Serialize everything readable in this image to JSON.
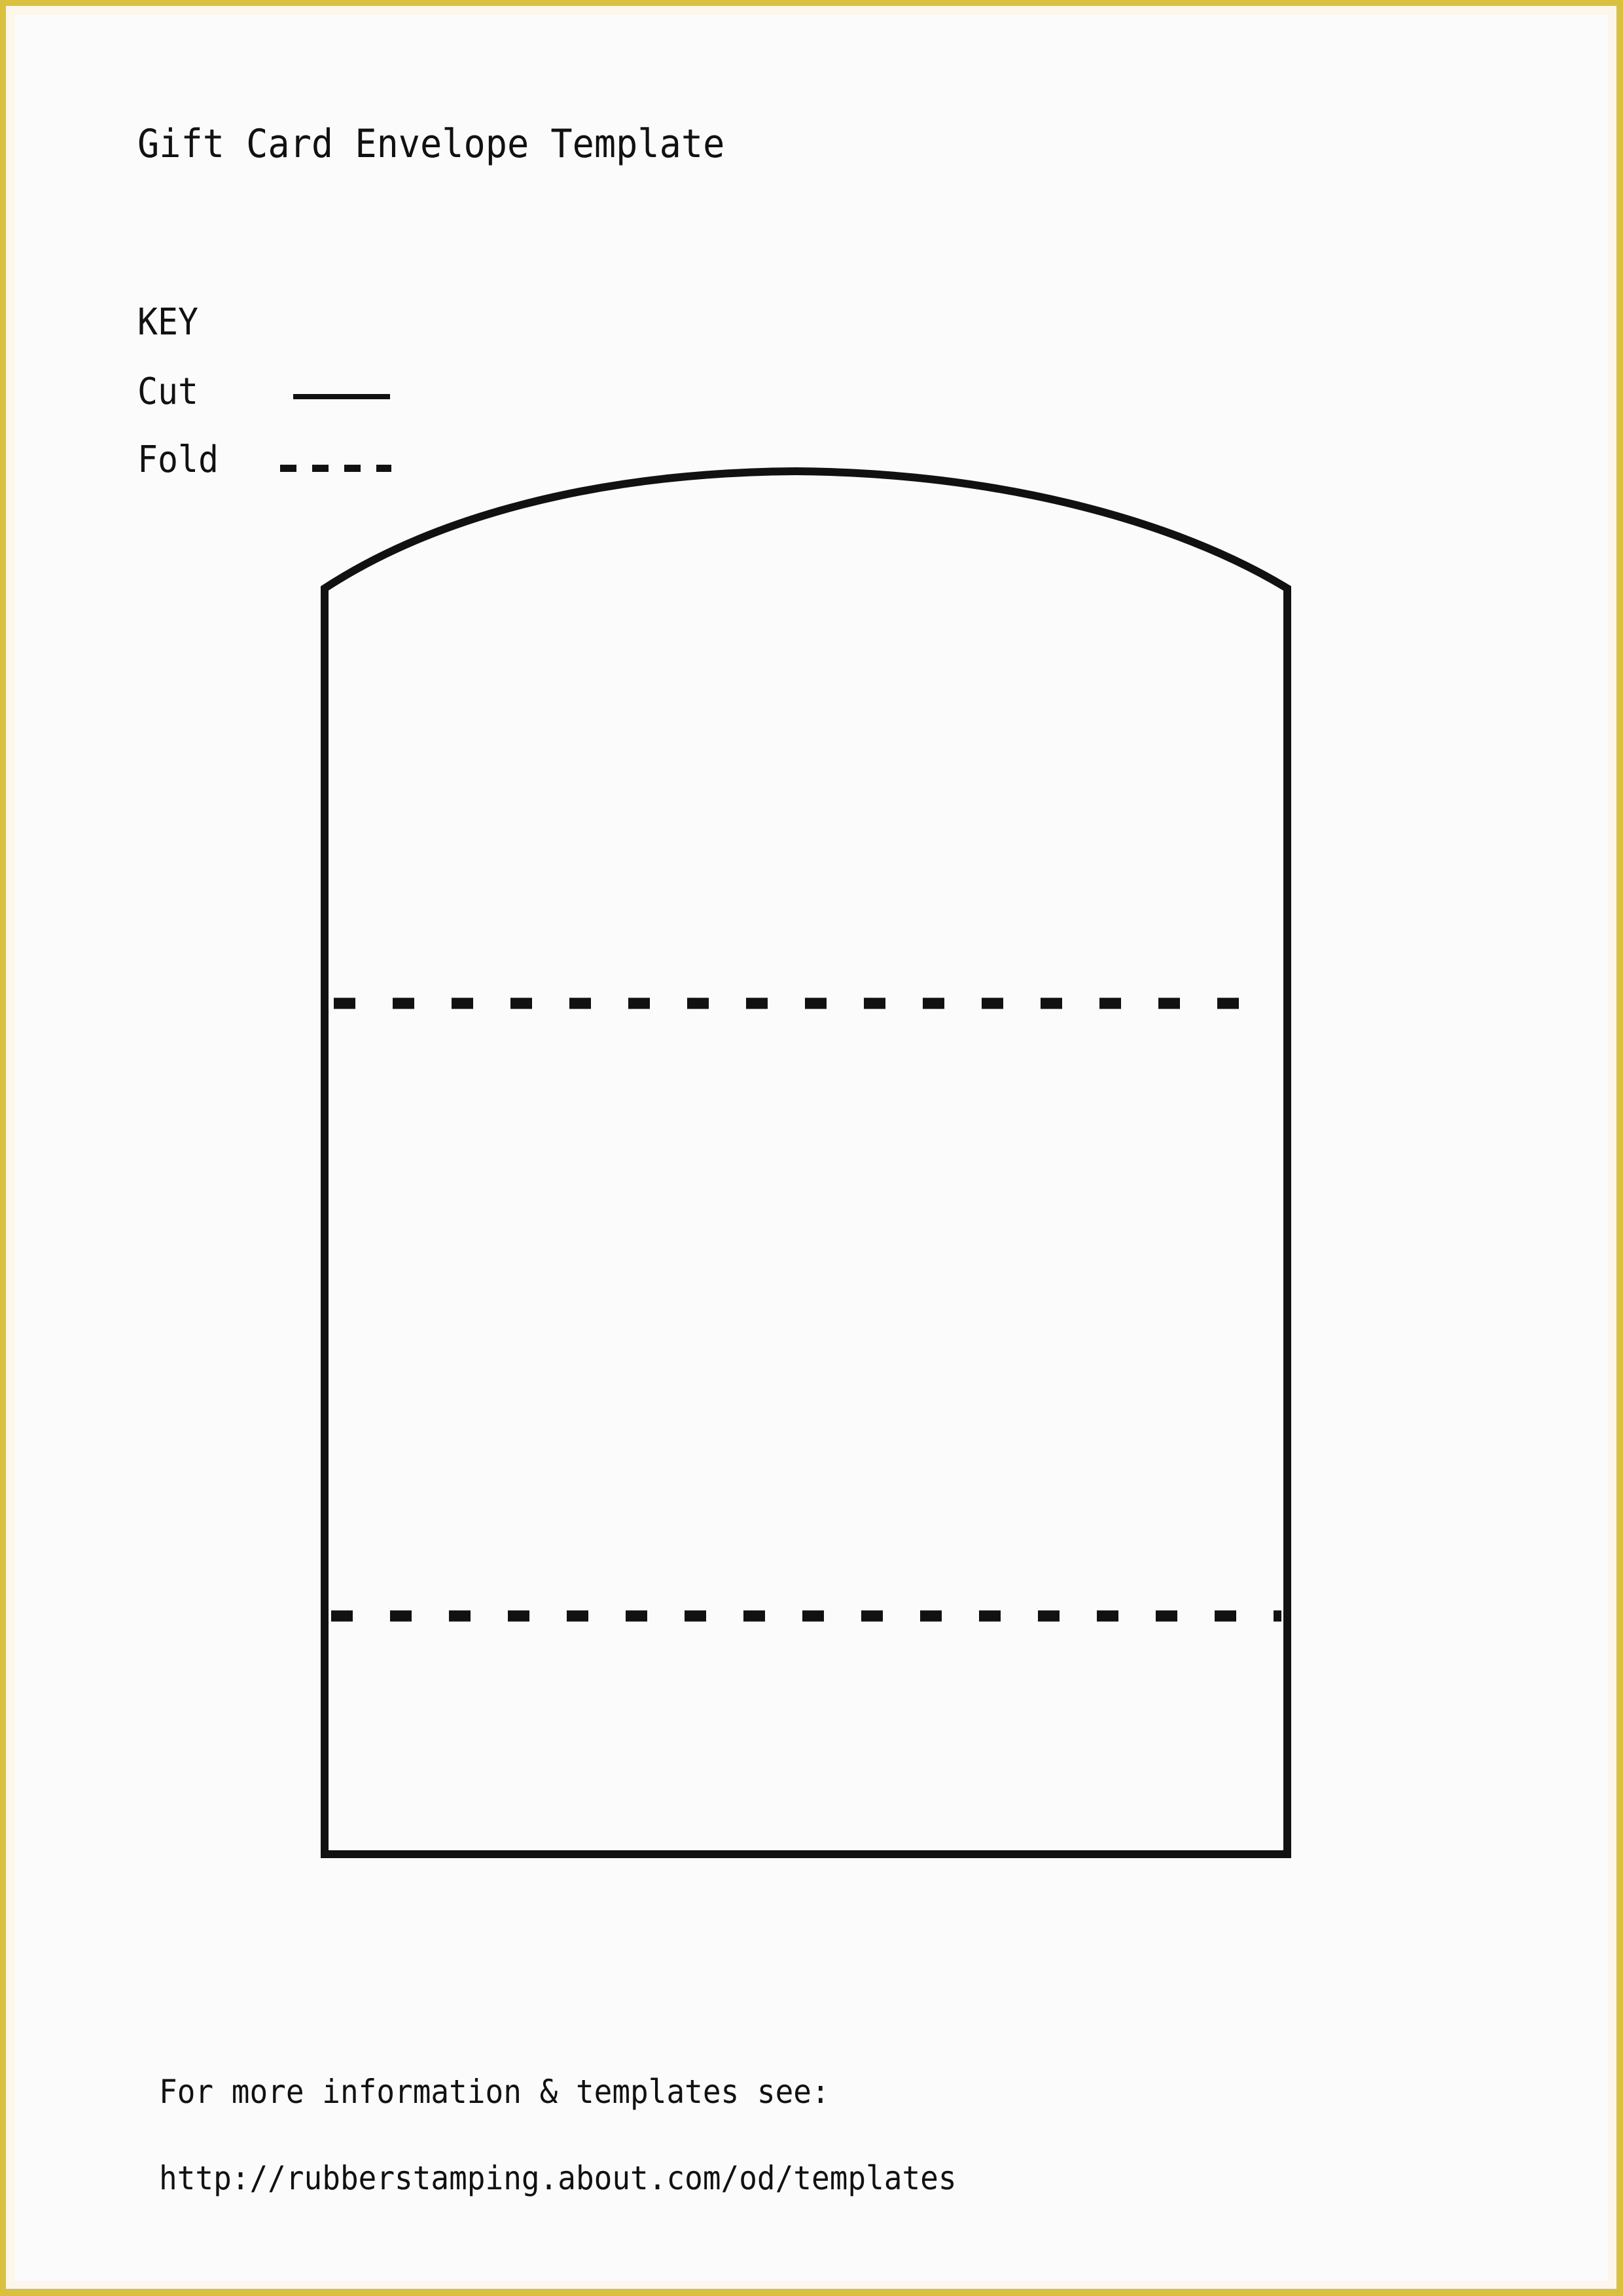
{
  "document": {
    "title": "Gift Card Envelope Template",
    "background_color": "#FBFBFC",
    "border_color": "#D9C13F",
    "ink_color": "#111111"
  },
  "key": {
    "heading": "KEY",
    "cut_label": "Cut",
    "cut_style": "solid-line",
    "fold_label": "Fold",
    "fold_style": "dashed-line"
  },
  "template": {
    "shape_name": "gift-card-envelope-outline",
    "cut_outline_description": "Arched flap top with straight sides and flat bottom",
    "fold_lines": 2
  },
  "footer": {
    "line1": "For more information & templates see:",
    "line2": "http://rubberstamping.about.com/od/templates"
  }
}
